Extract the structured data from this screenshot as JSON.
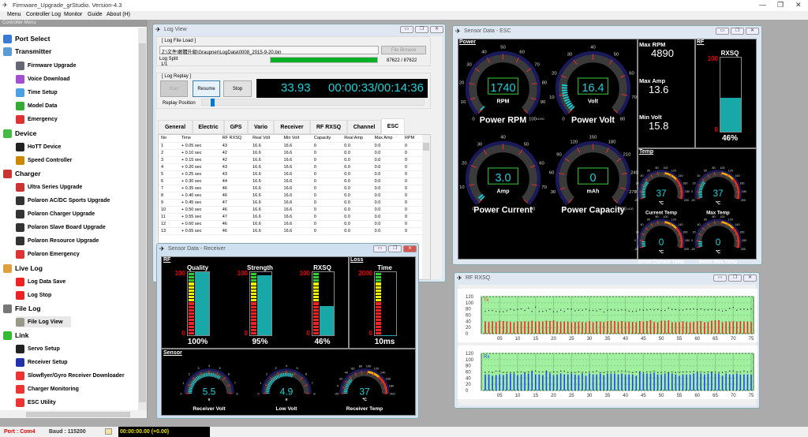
{
  "app": {
    "title": "Firmware_Upgrade_grStudio.   Version-4.3"
  },
  "menu": [
    "Menu",
    "Controller Log",
    "Monitor",
    "Guide",
    "About (H)"
  ],
  "sidebar": {
    "header": "Controller Menu",
    "items": [
      {
        "label": "Port Select",
        "level": 0,
        "icon": "usb-icon",
        "color": "#3a7bd5"
      },
      {
        "label": "Transmitter",
        "level": 0,
        "icon": "transmitter-icon",
        "color": "#5a9bd5"
      },
      {
        "label": "Firmware Upgrade",
        "level": 1,
        "icon": "firmware-icon",
        "color": "#667"
      },
      {
        "label": "Voice Download",
        "level": 1,
        "icon": "music-icon",
        "color": "#a24fd0"
      },
      {
        "label": "Time Setup",
        "level": 1,
        "icon": "clock-icon",
        "color": "#4aa0e0"
      },
      {
        "label": "Model Data",
        "level": 1,
        "icon": "plane-icon",
        "color": "#3a3"
      },
      {
        "label": "Emergency",
        "level": 1,
        "icon": "alarm-icon",
        "color": "#d33"
      },
      {
        "label": "Device",
        "level": 0,
        "icon": "download-icon",
        "color": "#4b4"
      },
      {
        "label": "HoTT Device",
        "level": 1,
        "icon": "device-icon",
        "color": "#222"
      },
      {
        "label": "Speed Controller",
        "level": 1,
        "icon": "esc-icon",
        "color": "#c80"
      },
      {
        "label": "Charger",
        "level": 0,
        "icon": "charger-icon",
        "color": "#c33"
      },
      {
        "label": "Ultra Series Upgrade",
        "level": 1,
        "icon": "charger-icon",
        "color": "#c33"
      },
      {
        "label": "Polaron AC/DC Sports Upgrade",
        "level": 1,
        "icon": "polaron-icon",
        "color": "#333"
      },
      {
        "label": "Polaron Charger Upgrade",
        "level": 1,
        "icon": "polaron-icon",
        "color": "#333"
      },
      {
        "label": "Polaron Slave Board Upgrade",
        "level": 1,
        "icon": "polaron-icon",
        "color": "#333"
      },
      {
        "label": "Polaron Resource Upgrade",
        "level": 1,
        "icon": "polaron-icon",
        "color": "#333"
      },
      {
        "label": "Polaron Emergency",
        "level": 1,
        "icon": "alarm-icon",
        "color": "#d33"
      },
      {
        "label": "Live Log",
        "level": 0,
        "icon": "magnifier-icon",
        "color": "#e0a040"
      },
      {
        "label": "Log Data Save",
        "level": 1,
        "icon": "record-icon",
        "color": "#e22"
      },
      {
        "label": "Log Stop",
        "level": 1,
        "icon": "stop-icon",
        "color": "#e22"
      },
      {
        "label": "File Log",
        "level": 0,
        "icon": "file-log-icon",
        "color": "#777"
      },
      {
        "label": "File Log View",
        "level": 1,
        "icon": "file-view-icon",
        "color": "#998",
        "selected": true
      },
      {
        "label": "Link",
        "level": 0,
        "icon": "arrow-right-icon",
        "color": "#3b3"
      },
      {
        "label": "Servo Setup",
        "level": 1,
        "icon": "servo-icon",
        "color": "#222"
      },
      {
        "label": "Receiver Setup",
        "level": 1,
        "icon": "receiver-icon",
        "color": "#23a"
      },
      {
        "label": "Slowflyer/Gyro Receiver Downloader",
        "level": 1,
        "icon": "graupner-icon",
        "color": "#e33"
      },
      {
        "label": "Charger Monitoring",
        "level": 1,
        "icon": "graupner-icon",
        "color": "#e33"
      },
      {
        "label": "ESC Utility",
        "level": 1,
        "icon": "graupner-icon",
        "color": "#e33"
      }
    ]
  },
  "status": {
    "port": "Port : Com4",
    "baud": "Baud : 115200",
    "time": "00:00:00.00   (+0.00)"
  },
  "logview": {
    "title": "Log View",
    "file_group": "[ Log File Load ]",
    "path": "Z:\\文件\\韌體升級\\Graupner\\LogData\\0008_2015-9-20.bin",
    "browse": "File Browse",
    "split_label": "Log Split",
    "split_value": "1/1",
    "load_progress": 1.0,
    "load_count": "87622 / 87622",
    "replay_group": "[ Log Replay ]",
    "start": "Start",
    "resume": "Resume",
    "stop": "Stop",
    "elapsed": "33.93",
    "clock": "00:00:33/00:14:36",
    "replay_label": "Replay Position",
    "replay_position": 0.04,
    "tabs": [
      "General",
      "Electric",
      "GPS",
      "Vario",
      "Receiver",
      "RF RXSQ",
      "Channel",
      "ESC"
    ],
    "active_tab": "ESC",
    "columns": [
      "No",
      "Time",
      "RF RXSQ",
      "Real Volt",
      "Min Volt",
      "Capacity",
      "Real Amp",
      "Max Amp",
      "RPM"
    ],
    "rows": [
      [
        "1",
        "+ 0.05 sec",
        "43",
        "16.6",
        "16.6",
        "0",
        "0.0",
        "0.0",
        "0"
      ],
      [
        "2",
        "+ 0.10 sec",
        "42",
        "16.6",
        "16.6",
        "0",
        "0.0",
        "0.0",
        "0"
      ],
      [
        "3",
        "+ 0.15 sec",
        "42",
        "16.6",
        "16.6",
        "0",
        "0.0",
        "0.0",
        "0"
      ],
      [
        "4",
        "+ 0.20 sec",
        "43",
        "16.6",
        "16.6",
        "0",
        "0.0",
        "0.0",
        "0"
      ],
      [
        "5",
        "+ 0.25 sec",
        "43",
        "16.6",
        "16.6",
        "0",
        "0.0",
        "0.0",
        "0"
      ],
      [
        "6",
        "+ 0.30 sec",
        "44",
        "16.6",
        "16.6",
        "0",
        "0.0",
        "0.0",
        "0"
      ],
      [
        "7",
        "+ 0.35 sec",
        "46",
        "16.6",
        "16.6",
        "0",
        "0.0",
        "0.0",
        "0"
      ],
      [
        "8",
        "+ 0.40 sec",
        "46",
        "16.6",
        "16.6",
        "0",
        "0.0",
        "0.0",
        "0"
      ],
      [
        "9",
        "+ 0.45 sec",
        "47",
        "16.6",
        "16.6",
        "0",
        "0.0",
        "0.0",
        "0"
      ],
      [
        "10",
        "+ 0.50 sec",
        "46",
        "16.6",
        "16.6",
        "0",
        "0.0",
        "0.0",
        "0"
      ],
      [
        "11",
        "+ 0.55 sec",
        "47",
        "16.6",
        "16.6",
        "0",
        "0.0",
        "0.0",
        "0"
      ],
      [
        "12",
        "+ 0.60 sec",
        "46",
        "16.6",
        "16.6",
        "0",
        "0.0",
        "0.0",
        "0"
      ],
      [
        "13",
        "+ 0.65 sec",
        "46",
        "16.6",
        "16.6",
        "0",
        "0.0",
        "0.0",
        "0"
      ]
    ]
  },
  "receiver": {
    "title": "Sensor Data - Receiver",
    "rf_section": "RF",
    "loss_section": "Loss",
    "sensor_section": "Sensor",
    "meters": [
      {
        "label": "Quality",
        "max": "100",
        "min": "0",
        "value": 100,
        "readout": "100%"
      },
      {
        "label": "Strength",
        "max": "100",
        "min": "0",
        "value": 95,
        "readout": "95%"
      },
      {
        "label": "RXSQ",
        "max": "100",
        "min": "0",
        "value": 46,
        "readout": "46%"
      },
      {
        "label": "Time",
        "max": "2000",
        "min": "0",
        "value": 10,
        "readout": "10ms"
      }
    ],
    "gauges": [
      {
        "label": "Receiver Volt",
        "unit": "v",
        "value": 5.5,
        "readout": "5.5",
        "min": 0,
        "max": 8,
        "ticks": [
          "0",
          "1",
          "2",
          "3",
          "4",
          "5",
          "6",
          "7",
          "8"
        ]
      },
      {
        "label": "Low Volt",
        "unit": "v",
        "value": 4.9,
        "readout": "4.9",
        "min": 0,
        "max": 8,
        "ticks": [
          "0",
          "1",
          "2",
          "3",
          "4",
          "5",
          "6",
          "7",
          "8"
        ]
      },
      {
        "label": "Receiver Temp",
        "unit": "℃",
        "value": 37,
        "readout": "37",
        "min": -20,
        "max": 200,
        "ticks": [
          "-20",
          "0",
          "20",
          "40",
          "60",
          "80",
          "100",
          "120",
          "140",
          "160",
          "180",
          "200"
        ],
        "warn": true
      }
    ]
  },
  "esc": {
    "title": "Sensor Data - ESC",
    "power_section": "Power",
    "rf_section": "RF",
    "temp_section": "Temp",
    "gauges": [
      {
        "label": "Power RPM",
        "unit": "RPM",
        "value": 1.74,
        "readout": "1740",
        "min": 0,
        "max": 100,
        "ticks": [
          "0",
          "10",
          "20",
          "30",
          "40",
          "50",
          "60",
          "70",
          "80",
          "90",
          "100"
        ],
        "scale_note": "x1000"
      },
      {
        "label": "Power Volt",
        "unit": "Volt",
        "value": 16.4,
        "readout": "16.4",
        "min": 0,
        "max": 80,
        "ticks": [
          "0",
          "10",
          "20",
          "30",
          "40",
          "50",
          "60",
          "70",
          "80"
        ]
      },
      {
        "label": "Power Current",
        "unit": "Amp",
        "value": 3.0,
        "readout": "3.0",
        "min": 0,
        "max": 80,
        "ticks": [
          "0",
          "10",
          "20",
          "30",
          "40",
          "50",
          "60",
          "70",
          "80"
        ]
      },
      {
        "label": "Power Capacity",
        "unit": "mAh",
        "value": 0,
        "readout": "0",
        "min": 0,
        "max": 300,
        "ticks": [
          "0",
          "30",
          "60",
          "90",
          "120",
          "150",
          "180",
          "210",
          "240",
          "270",
          "300"
        ],
        "scale_note": "x100"
      }
    ],
    "max_rpm_label": "Max RPM",
    "max_rpm": "4890",
    "max_amp_label": "Max Amp",
    "max_amp": "13.6",
    "min_volt_label": "Min Volt",
    "min_volt": "15.8",
    "rxsq": {
      "label": "RXSQ",
      "max": "100",
      "min": "0",
      "value": 46,
      "readout": "46%"
    },
    "temps": [
      {
        "label": "Current Temp",
        "unit": "℃",
        "value": 37,
        "readout": "37"
      },
      {
        "label": "Max Temp",
        "unit": "℃",
        "value": 37,
        "readout": "37"
      },
      {
        "label": "Motor Current Temp",
        "unit": "℃",
        "value": 0,
        "readout": "0"
      },
      {
        "label": "Motor Max Temp",
        "unit": "℃",
        "value": 0,
        "readout": "0"
      }
    ]
  },
  "rf_rxsq": {
    "title": "RF RXSQ",
    "chart_data": [
      {
        "type": "bar",
        "series_label": "Tx",
        "ylim": [
          0,
          120
        ],
        "yticks": [
          "120",
          "100",
          "80",
          "60",
          "40",
          "20",
          "0"
        ],
        "xticks": [
          "05",
          "10",
          "15",
          "20",
          "25",
          "30",
          "35",
          "40",
          "45",
          "50",
          "55",
          "60",
          "65",
          "70",
          "75"
        ],
        "grid": true,
        "bar_color": "#ff2020",
        "values": [
          40,
          38,
          40,
          38,
          42,
          41,
          40,
          38,
          37,
          39,
          39,
          40,
          39,
          42,
          39,
          40,
          39,
          42,
          41,
          43,
          39,
          38,
          39,
          39,
          37,
          38,
          39,
          38,
          37,
          41,
          37,
          40,
          39,
          38,
          40,
          42,
          41,
          38,
          41,
          38,
          39,
          38,
          37,
          41,
          39,
          41,
          44,
          38,
          37,
          42,
          42,
          43,
          37,
          37,
          38,
          40,
          38,
          37,
          38,
          40,
          41,
          37,
          38,
          42,
          43,
          44,
          37,
          39,
          39,
          40,
          39,
          40,
          39,
          39,
          38
        ],
        "markers": [
          72,
          75,
          75,
          72,
          71,
          71,
          74,
          79,
          76,
          78,
          80,
          75,
          83,
          72,
          86,
          72,
          72,
          74,
          79,
          71,
          71,
          76,
          72,
          80,
          79,
          74,
          76,
          76,
          79,
          75,
          75,
          74,
          78,
          70,
          76,
          77,
          76,
          75,
          77,
          76,
          73,
          72,
          73,
          77,
          76,
          77,
          78,
          77,
          78,
          75,
          75,
          83,
          78,
          78,
          76,
          76,
          79,
          79,
          80,
          78,
          80,
          77,
          77,
          78,
          78,
          76,
          73,
          75,
          82,
          85,
          76,
          79,
          79,
          78,
          80
        ]
      },
      {
        "type": "bar",
        "series_label": "Rx",
        "ylim": [
          0,
          120
        ],
        "yticks": [
          "120",
          "100",
          "80",
          "60",
          "40",
          "20",
          "0"
        ],
        "xticks": [
          "05",
          "10",
          "15",
          "20",
          "25",
          "30",
          "35",
          "40",
          "45",
          "50",
          "55",
          "60",
          "65",
          "70",
          "75"
        ],
        "grid": true,
        "bar_color": "#2040ff",
        "values": [
          52,
          52,
          48,
          50,
          52,
          50,
          54,
          55,
          55,
          50,
          52,
          58,
          55,
          62,
          52,
          52,
          50,
          62,
          55,
          50,
          52,
          55,
          52,
          52,
          55,
          52,
          50,
          55,
          48,
          55,
          52,
          52,
          55,
          50,
          55,
          55,
          55,
          52,
          55,
          52,
          52,
          52,
          48,
          62,
          55,
          55,
          55,
          58,
          52,
          52,
          55,
          58,
          55,
          52,
          48,
          52,
          52,
          52,
          55,
          58,
          55,
          52,
          55,
          60,
          55,
          55,
          48,
          55,
          52,
          52,
          55,
          52,
          52,
          52,
          52
        ],
        "markers": [
          58,
          60,
          58,
          63,
          63,
          58,
          58,
          58,
          58,
          60,
          60,
          58,
          60,
          63,
          63,
          60,
          60,
          63,
          58,
          60,
          60,
          63,
          63,
          58,
          58,
          58,
          60,
          58,
          58,
          60,
          60,
          63,
          58,
          58,
          60,
          60,
          60,
          63,
          63,
          63,
          60,
          58,
          60,
          60,
          58,
          60,
          60,
          63,
          58,
          58,
          60,
          58,
          60,
          58,
          58,
          60,
          60,
          60,
          62,
          60,
          60,
          58,
          60,
          60,
          60,
          58,
          58,
          60,
          63,
          63,
          60,
          60,
          63,
          60,
          63
        ]
      }
    ]
  }
}
